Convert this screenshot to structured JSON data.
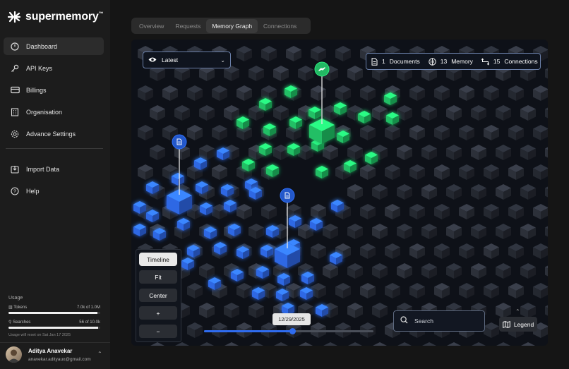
{
  "app": {
    "name": "supermemory",
    "trademark": "™"
  },
  "sidebar": {
    "items": [
      {
        "label": "Dashboard",
        "icon": "gauge-icon",
        "active": true
      },
      {
        "label": "API Keys",
        "icon": "key-icon"
      },
      {
        "label": "Billings",
        "icon": "credit-card-icon"
      },
      {
        "label": "Organisation",
        "icon": "building-icon"
      },
      {
        "label": "Advance Settings",
        "icon": "gear-icon"
      }
    ],
    "secondary": [
      {
        "label": "Import Data",
        "icon": "import-icon"
      },
      {
        "label": "Help",
        "icon": "help-icon"
      }
    ],
    "usage": {
      "title": "Usage",
      "tokens": {
        "label": "Tokens",
        "value": "7.0k of 1.0M",
        "fraction": 0.97
      },
      "searches": {
        "label": "Searches",
        "value": "56 of 10.0k",
        "fraction": 0.98
      },
      "reset_note": "Usage will reset on Sat Jan 17 2025"
    },
    "user": {
      "name": "Aditya Anavekar",
      "email": "anavekar.adityaux@gmail.com"
    }
  },
  "tabs": [
    {
      "label": "Overview"
    },
    {
      "label": "Requests"
    },
    {
      "label": "Memory Graph",
      "active": true
    },
    {
      "label": "Connections"
    }
  ],
  "graph": {
    "filter": {
      "label": "Latest",
      "icon": "eye-icon"
    },
    "stats": {
      "documents_count": "1",
      "documents_label": "Documents",
      "memory_count": "13",
      "memory_label": "Memory",
      "connections_count": "15",
      "connections_label": "Connections"
    },
    "controls": {
      "timeline": "Timeline",
      "fit": "Fit",
      "center": "Center",
      "zoom_in": "+",
      "zoom_out": "−"
    },
    "timeline": {
      "date": "12/29/2025",
      "position": 0.52
    },
    "search": {
      "placeholder": "Search"
    },
    "legend": {
      "label": "Legend",
      "icon": "map-icon"
    },
    "colors": {
      "blue": "#2f6cf0",
      "green": "#22c96a",
      "gray": "#2a2e38"
    }
  }
}
